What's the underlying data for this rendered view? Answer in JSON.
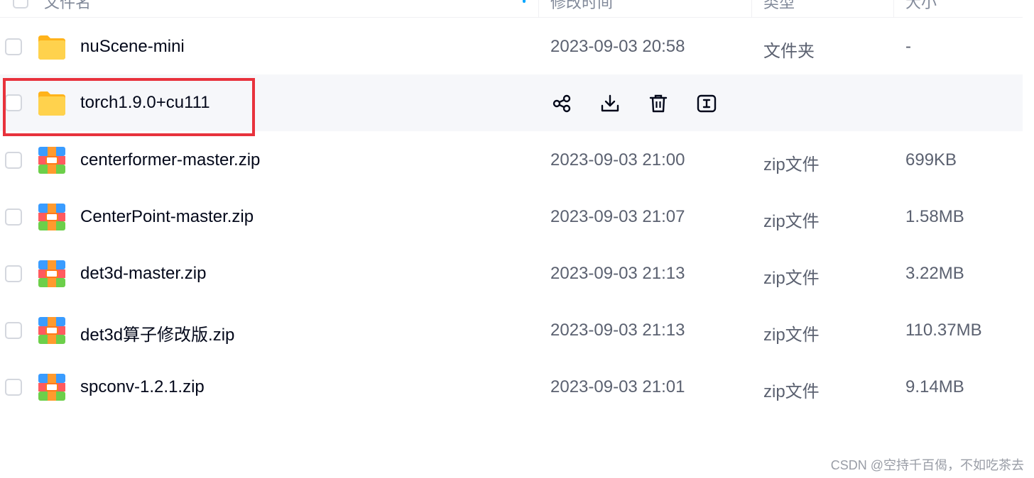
{
  "header": {
    "columns": [
      "文件名",
      "修改时间",
      "类型",
      "大小"
    ]
  },
  "files": [
    {
      "name": "nuScene-mini",
      "date": "2023-09-03 20:58",
      "type": "文件夹",
      "size": "-",
      "icon": "folder-icon"
    },
    {
      "name": "torch1.9.0+cu111",
      "date": "",
      "type": "",
      "size": "",
      "icon": "folder-icon"
    },
    {
      "name": "centerformer-master.zip",
      "date": "2023-09-03 21:00",
      "type": "zip文件",
      "size": "699KB",
      "icon": "zip-icon"
    },
    {
      "name": "CenterPoint-master.zip",
      "date": "2023-09-03 21:07",
      "type": "zip文件",
      "size": "1.58MB",
      "icon": "zip-icon"
    },
    {
      "name": "det3d-master.zip",
      "date": "2023-09-03 21:13",
      "type": "zip文件",
      "size": "3.22MB",
      "icon": "zip-icon"
    },
    {
      "name": "det3d算子修改版.zip",
      "date": "2023-09-03 21:13",
      "type": "zip文件",
      "size": "110.37MB",
      "icon": "zip-icon"
    },
    {
      "name": "spconv-1.2.1.zip",
      "date": "2023-09-03 21:01",
      "type": "zip文件",
      "size": "9.14MB",
      "icon": "zip-icon"
    }
  ],
  "hover_actions": [
    "share-icon",
    "download-icon",
    "delete-icon",
    "rename-icon"
  ],
  "watermark": "CSDN @空持千百偈，不如吃茶去",
  "colors": {
    "accent": "#06a7ff",
    "highlight_box": "#e8323c",
    "hover_row": "#f6f7fa",
    "folder": "#ffc53d"
  }
}
